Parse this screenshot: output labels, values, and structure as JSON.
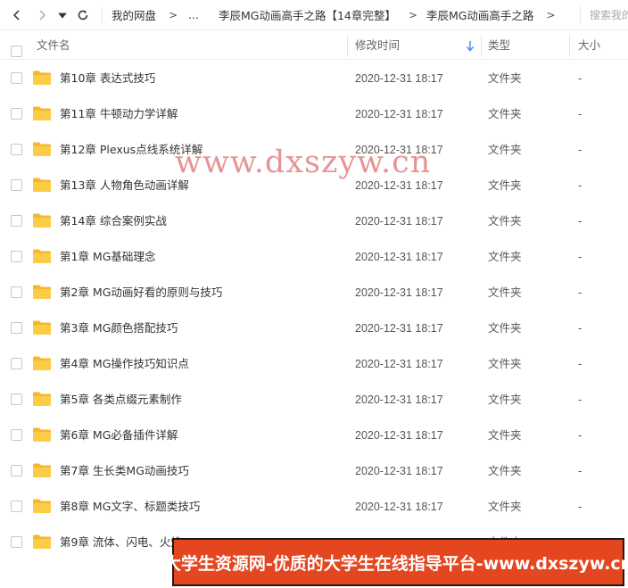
{
  "breadcrumb": {
    "root": "我的网盘",
    "ellipsis": "...",
    "level1": "李辰MG动画高手之路【14章完整】",
    "level2": "李辰MG动画高手之路",
    "arrow": ">"
  },
  "search": {
    "placeholder": "搜索我的"
  },
  "columns": {
    "name": "文件名",
    "modified": "修改时间",
    "type": "类型",
    "size": "大小"
  },
  "colors": {
    "accent": "#3b8cff",
    "folder": "#f7c23c",
    "banner_bg": "#e4461f",
    "watermark": "#d23c3c"
  },
  "files": [
    {
      "name": "第10章 表达式技巧",
      "modified": "2020-12-31 18:17",
      "type": "文件夹",
      "size": "-"
    },
    {
      "name": "第11章 牛顿动力学详解",
      "modified": "2020-12-31 18:17",
      "type": "文件夹",
      "size": "-"
    },
    {
      "name": "第12章 Plexus点线系统详解",
      "modified": "2020-12-31 18:17",
      "type": "文件夹",
      "size": "-"
    },
    {
      "name": "第13章 人物角色动画详解",
      "modified": "2020-12-31 18:17",
      "type": "文件夹",
      "size": "-"
    },
    {
      "name": "第14章 综合案例实战",
      "modified": "2020-12-31 18:17",
      "type": "文件夹",
      "size": "-"
    },
    {
      "name": "第1章 MG基础理念",
      "modified": "2020-12-31 18:17",
      "type": "文件夹",
      "size": "-"
    },
    {
      "name": "第2章 MG动画好看的原则与技巧",
      "modified": "2020-12-31 18:17",
      "type": "文件夹",
      "size": "-"
    },
    {
      "name": "第3章 MG颜色搭配技巧",
      "modified": "2020-12-31 18:17",
      "type": "文件夹",
      "size": "-"
    },
    {
      "name": "第4章 MG操作技巧知识点",
      "modified": "2020-12-31 18:17",
      "type": "文件夹",
      "size": "-"
    },
    {
      "name": "第5章 各类点缀元素制作",
      "modified": "2020-12-31 18:17",
      "type": "文件夹",
      "size": "-"
    },
    {
      "name": "第6章 MG必备插件详解",
      "modified": "2020-12-31 18:17",
      "type": "文件夹",
      "size": "-"
    },
    {
      "name": "第7章 生长类MG动画技巧",
      "modified": "2020-12-31 18:17",
      "type": "文件夹",
      "size": "-"
    },
    {
      "name": "第8章 MG文字、标题类技巧",
      "modified": "2020-12-31 18:17",
      "type": "文件夹",
      "size": "-"
    },
    {
      "name": "第9章 流体、闪电、火焰",
      "modified": "2020-12-31 18:17",
      "type": "文件夹",
      "size": "-"
    }
  ],
  "watermark": {
    "text": "www.dxszyw.cn"
  },
  "banner": {
    "text": "大学生资源网-优质的大学生在线指导平台-www.dxszyw.cn"
  }
}
